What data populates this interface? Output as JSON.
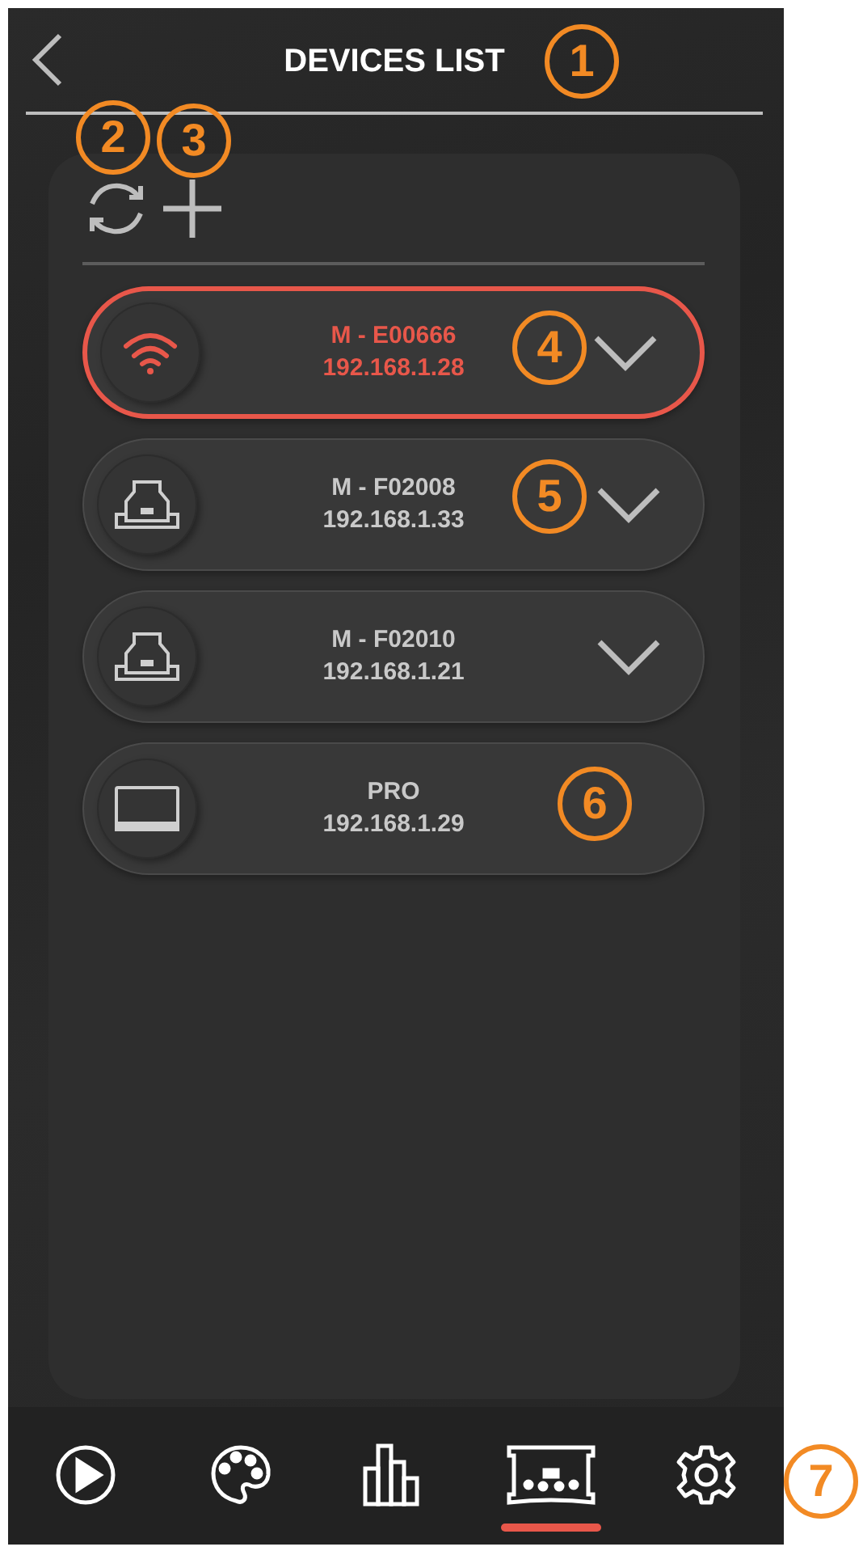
{
  "header": {
    "title": "DEVICES LIST"
  },
  "devices": [
    {
      "kind": "wifi",
      "name": "M - E00666",
      "ip": "192.168.1.28",
      "selected": true,
      "expandable": true
    },
    {
      "kind": "printer",
      "name": "M - F02008",
      "ip": "192.168.1.33",
      "selected": false,
      "expandable": true
    },
    {
      "kind": "printer",
      "name": "M - F02010",
      "ip": "192.168.1.21",
      "selected": false,
      "expandable": true
    },
    {
      "kind": "laptop",
      "name": "PRO",
      "ip": "192.168.1.29",
      "selected": false,
      "expandable": false
    }
  ],
  "nav": [
    {
      "kind": "play",
      "selected": false
    },
    {
      "kind": "palette",
      "selected": false
    },
    {
      "kind": "chart",
      "selected": false
    },
    {
      "kind": "device",
      "selected": true
    },
    {
      "kind": "settings",
      "selected": false
    }
  ],
  "callouts": [
    {
      "label": "1"
    },
    {
      "label": "2"
    },
    {
      "label": "3"
    },
    {
      "label": "4"
    },
    {
      "label": "5"
    },
    {
      "label": "6"
    },
    {
      "label": "7"
    }
  ]
}
